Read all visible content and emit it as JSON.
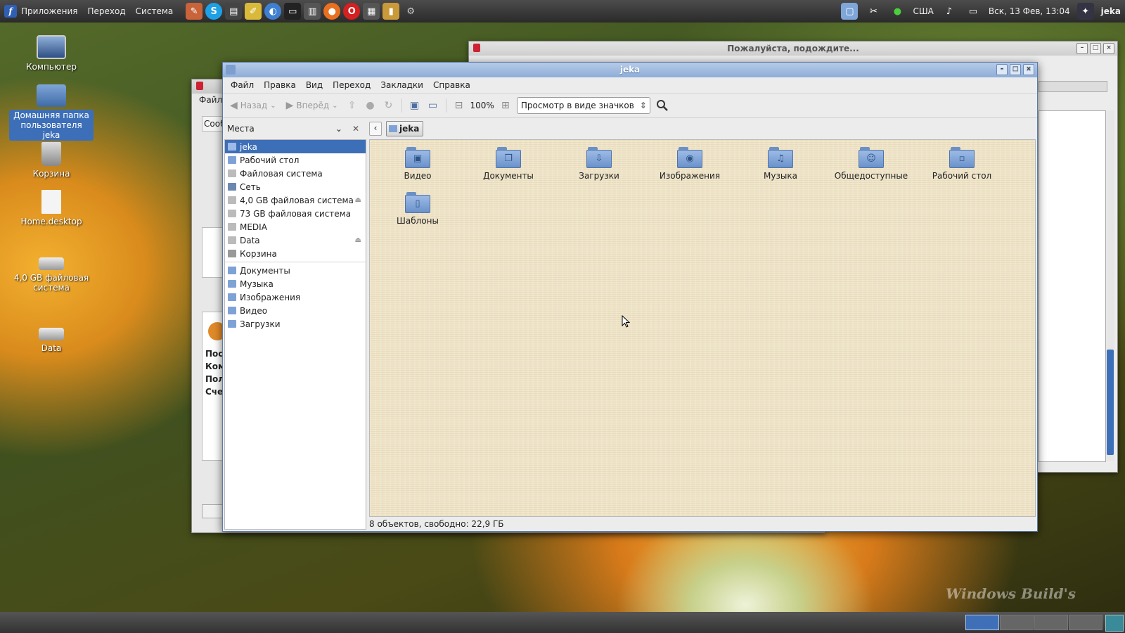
{
  "top_panel": {
    "menus": [
      "Приложения",
      "Переход",
      "Система"
    ],
    "layout": "США",
    "clock": "Вск, 13 Фев, 13:04",
    "user": "jeka"
  },
  "desktop": {
    "icons": [
      {
        "label": "Компьютер"
      },
      {
        "label": "Домашняя папка пользователя jeka"
      },
      {
        "label": "Корзина"
      },
      {
        "label": "Home.desktop"
      },
      {
        "label": "4,0 GB файловая система"
      },
      {
        "label": "Data"
      }
    ],
    "watermark": "Windows Build's"
  },
  "wait_window": {
    "title": "Пожалуйста, подождите..."
  },
  "back_window": {
    "menu": "Файл",
    "fragments": [
      "Сооб",
      "Пос.",
      "Ком",
      "Пол",
      "Счет"
    ]
  },
  "main_window": {
    "title": "jeka",
    "menu": [
      "Файл",
      "Правка",
      "Вид",
      "Переход",
      "Закладки",
      "Справка"
    ],
    "toolbar": {
      "back": "Назад",
      "forward": "Вперёд",
      "zoom": "100%",
      "view_mode": "Просмотр в виде значков"
    },
    "sidebar": {
      "header": "Места",
      "places": [
        {
          "label": "jeka"
        },
        {
          "label": "Рабочий стол"
        },
        {
          "label": "Файловая система"
        },
        {
          "label": "Сеть"
        },
        {
          "label": "4,0 GB файловая система"
        },
        {
          "label": "73 GB файловая система"
        },
        {
          "label": "MEDIA"
        },
        {
          "label": "Data"
        },
        {
          "label": "Корзина"
        }
      ],
      "bookmarks": [
        {
          "label": "Документы"
        },
        {
          "label": "Музыка"
        },
        {
          "label": "Изображения"
        },
        {
          "label": "Видео"
        },
        {
          "label": "Загрузки"
        }
      ]
    },
    "path": "jeka",
    "files": [
      {
        "label": "Видео",
        "glyph": "▣"
      },
      {
        "label": "Документы",
        "glyph": "❐"
      },
      {
        "label": "Загрузки",
        "glyph": "⇩"
      },
      {
        "label": "Изображения",
        "glyph": "◉"
      },
      {
        "label": "Музыка",
        "glyph": "♫"
      },
      {
        "label": "Общедоступные",
        "glyph": "☺"
      },
      {
        "label": "Рабочий стол",
        "glyph": "▫"
      },
      {
        "label": "Шаблоны",
        "glyph": "▯"
      }
    ],
    "status": "8 объектов, свободно: 22,9 ГБ"
  },
  "colors": {
    "selection": "#3d6fb8",
    "folder": "#7fa2d6",
    "titlebar": "#8eadd8"
  }
}
